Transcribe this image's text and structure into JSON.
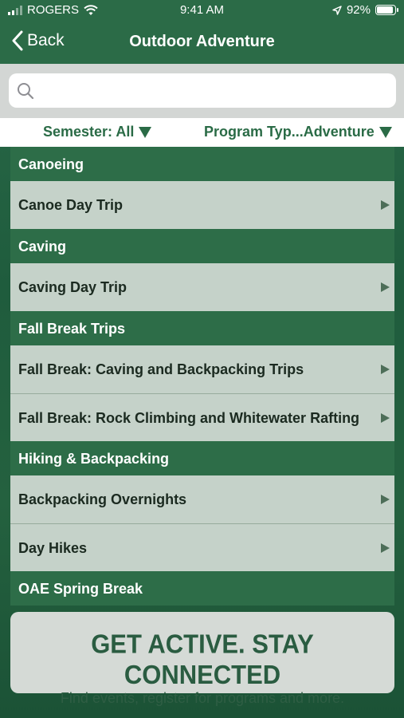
{
  "status_bar": {
    "carrier": "ROGERS",
    "time": "9:41 AM",
    "battery": "92%",
    "battery_level": 0.92,
    "icons": [
      "signal-icon",
      "wifi-icon",
      "location-arrow-icon",
      "battery-icon"
    ]
  },
  "nav": {
    "back_label": "Back",
    "title": "Outdoor Adventure"
  },
  "search": {
    "value": "",
    "placeholder": "",
    "icon": "search-icon"
  },
  "filters": {
    "semester": "Semester: All",
    "program_type": "Program Typ...Adventure"
  },
  "sections": [
    {
      "header": "Canoeing",
      "items": [
        "Canoe Day Trip"
      ]
    },
    {
      "header": "Caving",
      "items": [
        "Caving Day Trip"
      ]
    },
    {
      "header": "Fall Break Trips",
      "items": [
        "Fall Break: Caving and Backpacking Trips",
        "Fall Break: Rock Climbing and Whitewater Rafting"
      ]
    },
    {
      "header": "Hiking & Backpacking",
      "items": [
        "Backpacking Overnights",
        "Day Hikes"
      ]
    },
    {
      "header": "OAE Spring Break",
      "items": []
    }
  ],
  "banner": {
    "headline": "GET ACTIVE.  STAY CONNECTED",
    "subline": "Find events, register for programs and more."
  },
  "colors": {
    "brand_green": "#2b6b47",
    "row_bg": "#c5d2c9",
    "filter_text": "#2a6b46"
  }
}
